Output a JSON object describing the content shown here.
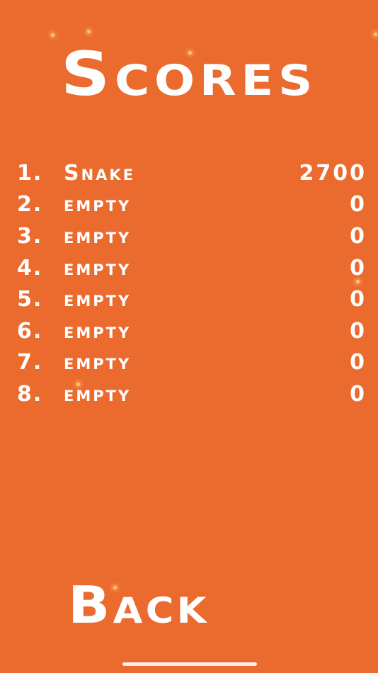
{
  "screen": {
    "title": "Scores",
    "background_color": "#EB6A2E",
    "text_color": "#FFFFFF"
  },
  "scores": [
    {
      "rank": "1.",
      "name": "Snake",
      "score": "2700"
    },
    {
      "rank": "2.",
      "name": "empty",
      "score": "0"
    },
    {
      "rank": "3.",
      "name": "empty",
      "score": "0"
    },
    {
      "rank": "4.",
      "name": "empty",
      "score": "0"
    },
    {
      "rank": "5.",
      "name": "empty",
      "score": "0"
    },
    {
      "rank": "6.",
      "name": "empty",
      "score": "0"
    },
    {
      "rank": "7.",
      "name": "empty",
      "score": "0"
    },
    {
      "rank": "8.",
      "name": "empty",
      "score": "0"
    }
  ],
  "back_button": {
    "label": "Back"
  }
}
